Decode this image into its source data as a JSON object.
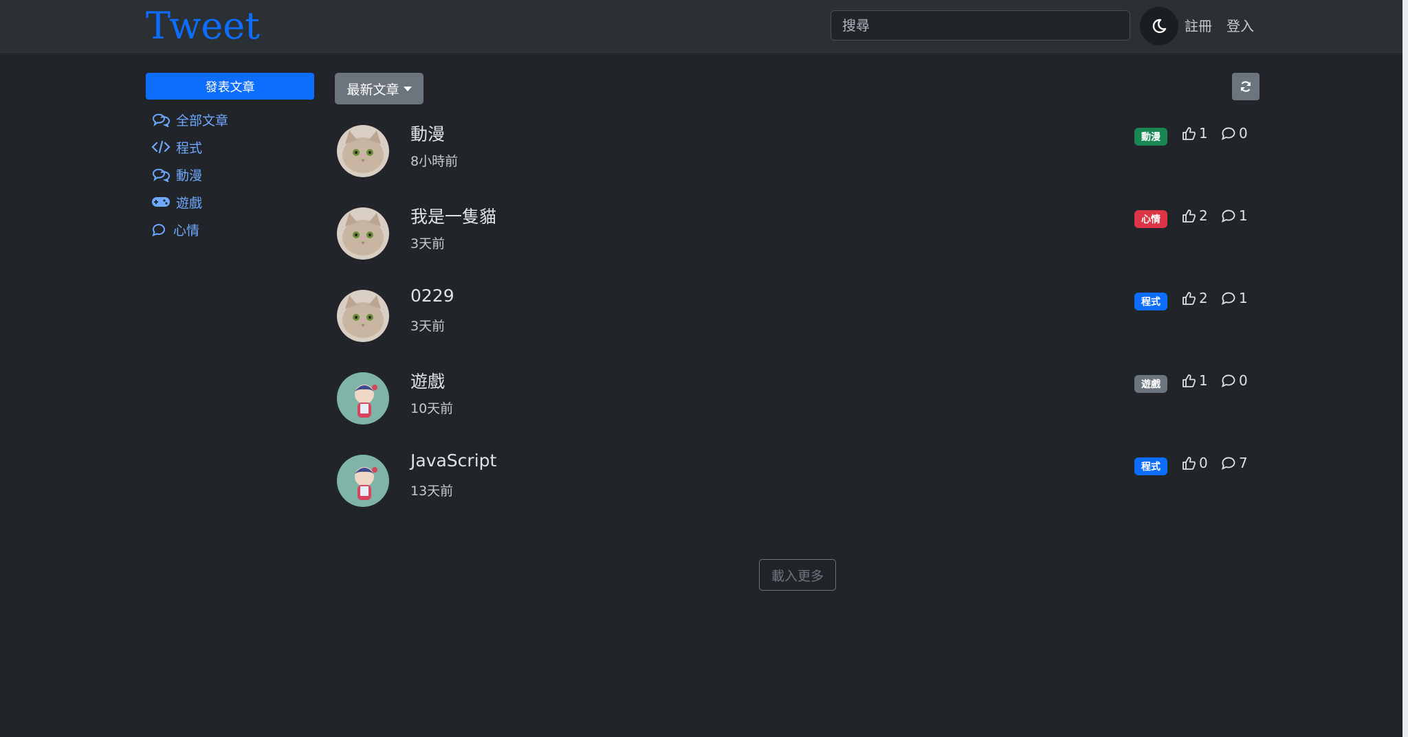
{
  "navbar": {
    "brand": "Tweet",
    "search_placeholder": "搜尋",
    "theme_icon": "moon-icon",
    "register": "註冊",
    "login": "登入"
  },
  "sidebar": {
    "post_button": "發表文章",
    "items": [
      {
        "label": "全部文章",
        "icon": "chat-dots-icon"
      },
      {
        "label": "程式",
        "icon": "code-icon"
      },
      {
        "label": "動漫",
        "icon": "chat-dots-icon"
      },
      {
        "label": "遊戲",
        "icon": "gamepad-icon"
      },
      {
        "label": "心情",
        "icon": "chat-bubble-icon"
      }
    ]
  },
  "main": {
    "sort_label": "最新文章",
    "refresh_icon": "refresh-icon",
    "posts": [
      {
        "title": "動漫",
        "time": "8小時前",
        "tag": "動漫",
        "tag_color": "#198754",
        "likes": "1",
        "comments": "0",
        "avatar": "cat"
      },
      {
        "title": "我是一隻貓",
        "time": "3天前",
        "tag": "心情",
        "tag_color": "#dc3545",
        "likes": "2",
        "comments": "1",
        "avatar": "cat"
      },
      {
        "title": "0229",
        "time": "3天前",
        "tag": "程式",
        "tag_color": "#0d6efd",
        "likes": "2",
        "comments": "1",
        "avatar": "cat"
      },
      {
        "title": "遊戲",
        "time": "10天前",
        "tag": "遊戲",
        "tag_color": "#6c757d",
        "likes": "1",
        "comments": "0",
        "avatar": "doll"
      },
      {
        "title": "JavaScript",
        "time": "13天前",
        "tag": "程式",
        "tag_color": "#0d6efd",
        "likes": "0",
        "comments": "7",
        "avatar": "doll"
      }
    ],
    "load_more": "載入更多"
  },
  "colors": {
    "background": "#212529",
    "navbar": "#2b3035",
    "primary": "#0d6efd",
    "link": "#6ea8fe"
  }
}
